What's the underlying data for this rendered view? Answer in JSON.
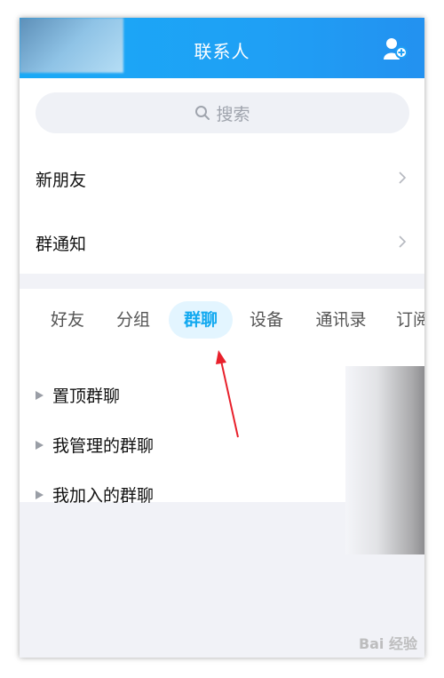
{
  "header": {
    "title": "联系人"
  },
  "search": {
    "placeholder": "搜索"
  },
  "entries": [
    {
      "label": "新朋友"
    },
    {
      "label": "群通知"
    }
  ],
  "tabs": [
    {
      "label": "好友",
      "active": false
    },
    {
      "label": "分组",
      "active": false
    },
    {
      "label": "群聊",
      "active": true
    },
    {
      "label": "设备",
      "active": false
    },
    {
      "label": "通讯录",
      "active": false
    },
    {
      "label": "订阅",
      "active": false
    }
  ],
  "groups": [
    {
      "label": "置顶群聊"
    },
    {
      "label": "我管理的群聊"
    },
    {
      "label": "我加入的群聊"
    }
  ],
  "watermark": {
    "text": "Bai 经验"
  },
  "colors": {
    "accent": "#1fa0f5",
    "active_tab_bg": "#e3f5ff",
    "active_tab_text": "#12a9f0",
    "arrow": "#e8202b"
  }
}
